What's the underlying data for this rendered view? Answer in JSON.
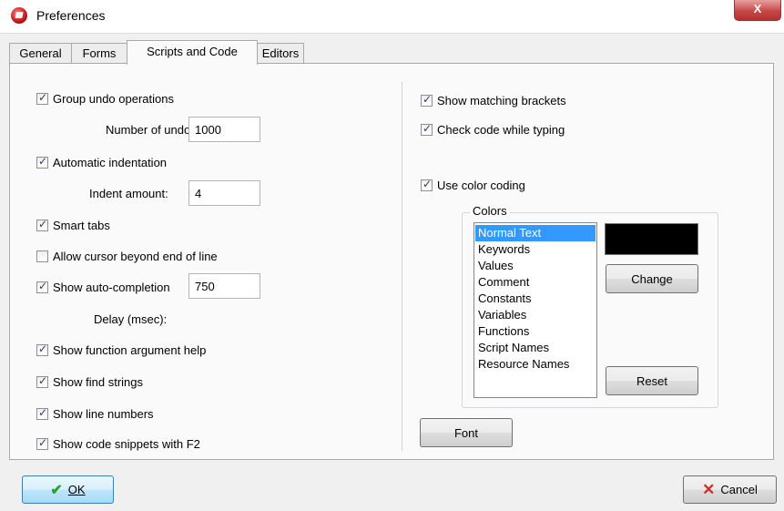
{
  "window": {
    "title": "Preferences",
    "close_glyph": "X"
  },
  "tabs": [
    {
      "label": "General"
    },
    {
      "label": "Forms"
    },
    {
      "label": "Scripts and Code"
    },
    {
      "label": "Editors"
    }
  ],
  "active_tab": "Scripts and Code",
  "left": {
    "group_undo": {
      "label": "Group undo operations",
      "checked": true
    },
    "number_of_undo": {
      "label": "Number of undo:",
      "value": "1000"
    },
    "automatic_indentation": {
      "label": "Automatic indentation",
      "checked": true
    },
    "indent_amount": {
      "label": "Indent amount:",
      "value": "4"
    },
    "smart_tabs": {
      "label": "Smart tabs",
      "checked": true
    },
    "allow_cursor": {
      "label": "Allow cursor beyond end of line",
      "checked": false
    },
    "auto_completion": {
      "label": "Show auto-completion",
      "checked": true,
      "value": "750",
      "delay_label": "Delay (msec):"
    },
    "function_help": {
      "label": "Show function argument help",
      "checked": true
    },
    "find_strings": {
      "label": "Show find strings",
      "checked": true
    },
    "line_numbers": {
      "label": "Show line numbers",
      "checked": true
    },
    "code_snippets": {
      "label": "Show code snippets with F2",
      "checked": true
    }
  },
  "right": {
    "matching_brackets": {
      "label": "Show matching brackets",
      "checked": true
    },
    "check_code": {
      "label": "Check code while typing",
      "checked": true
    },
    "color_coding": {
      "label": "Use color coding",
      "checked": true
    },
    "colors": {
      "legend": "Colors",
      "items": [
        "Normal Text",
        "Keywords",
        "Values",
        "Comment",
        "Constants",
        "Variables",
        "Functions",
        "Script Names",
        "Resource Names"
      ],
      "selected": "Normal Text",
      "swatch_color": "#000000",
      "change_label": "Change",
      "reset_label": "Reset"
    },
    "font_label": "Font"
  },
  "footer": {
    "ok_label": "OK",
    "cancel_label": "Cancel"
  }
}
